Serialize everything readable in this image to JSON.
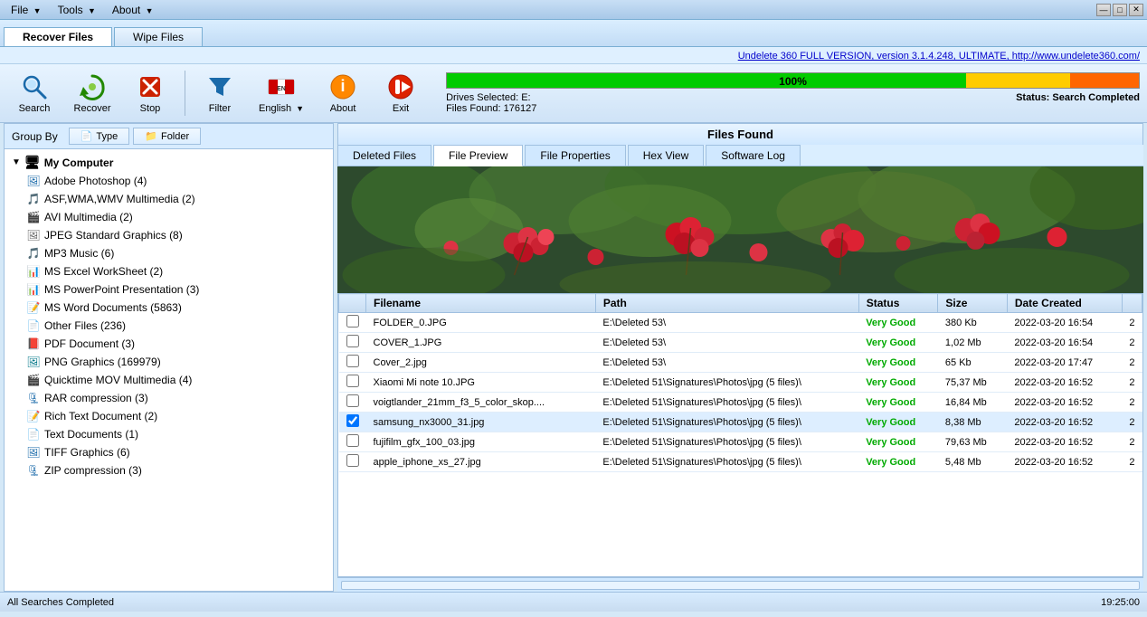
{
  "titlebar": {
    "menus": [
      {
        "label": "File",
        "has_arrow": true
      },
      {
        "label": "Tools",
        "has_arrow": true
      },
      {
        "label": "About",
        "has_arrow": true
      }
    ],
    "win_controls": [
      "—",
      "□",
      "✕"
    ]
  },
  "tabs": {
    "main_tabs": [
      "Recover Files",
      "Wipe Files"
    ],
    "active_main": "Recover Files"
  },
  "link_bar": {
    "text": "Undelete 360 FULL VERSION, version 3.1.4.248, ULTIMATE, http://www.undelete360.com/"
  },
  "toolbar": {
    "buttons": [
      {
        "id": "search",
        "label": "Search",
        "icon": "🔍"
      },
      {
        "id": "recover",
        "label": "Recover",
        "icon": "♻"
      },
      {
        "id": "stop",
        "label": "Stop",
        "icon": "✖"
      },
      {
        "id": "filter",
        "label": "Filter",
        "icon": "▼"
      },
      {
        "id": "english",
        "label": "English",
        "icon": "🌐",
        "has_arrow": true
      },
      {
        "id": "about",
        "label": "About",
        "icon": "ℹ"
      },
      {
        "id": "exit",
        "label": "Exit",
        "icon": "⏹"
      }
    ]
  },
  "progress": {
    "percent": "100%",
    "drives_selected": "Drives Selected: E:",
    "files_found": "Files Found: 176127",
    "status_label": "Status:",
    "status_value": "Search Completed",
    "bar_green_pct": 75,
    "bar_yellow_pct": 15,
    "bar_orange_pct": 10
  },
  "group_by": {
    "label": "Group By",
    "buttons": [
      {
        "id": "type",
        "label": "Type",
        "icon": "📄"
      },
      {
        "id": "folder",
        "label": "Folder",
        "icon": "📁"
      }
    ]
  },
  "tree": {
    "root": {
      "label": "My Computer",
      "icon": "🖥",
      "expanded": true
    },
    "items": [
      {
        "label": "Adobe Photoshop (4)",
        "icon": "🖼",
        "color": "icon-blue"
      },
      {
        "label": "ASF,WMA,WMV Multimedia (2)",
        "icon": "🎵",
        "color": "icon-blue"
      },
      {
        "label": "AVI Multimedia (2)",
        "icon": "🎬",
        "color": "icon-blue"
      },
      {
        "label": "JPEG Standard Graphics (8)",
        "icon": "🖼",
        "color": "icon-gray"
      },
      {
        "label": "MP3 Music (6)",
        "icon": "🎵",
        "color": "icon-gray"
      },
      {
        "label": "MS Excel WorkSheet (2)",
        "icon": "📊",
        "color": "icon-green"
      },
      {
        "label": "MS PowerPoint Presentation (3)",
        "icon": "📊",
        "color": "icon-orange"
      },
      {
        "label": "MS Word Documents (5863)",
        "icon": "📝",
        "color": "icon-blue"
      },
      {
        "label": "Other Files (236)",
        "icon": "📄",
        "color": "icon-gray"
      },
      {
        "label": "PDF Document (3)",
        "icon": "📕",
        "color": "icon-red"
      },
      {
        "label": "PNG Graphics (169979)",
        "icon": "🖼",
        "color": "icon-teal"
      },
      {
        "label": "Quicktime MOV Multimedia (4)",
        "icon": "🎬",
        "color": "icon-blue"
      },
      {
        "label": "RAR compression (3)",
        "icon": "🗜",
        "color": "icon-blue"
      },
      {
        "label": "Rich Text Document (2)",
        "icon": "📝",
        "color": "icon-blue"
      },
      {
        "label": "Text Documents (1)",
        "icon": "📄",
        "color": "icon-gray"
      },
      {
        "label": "TIFF Graphics (6)",
        "icon": "🖼",
        "color": "icon-blue"
      },
      {
        "label": "ZIP compression (3)",
        "icon": "🗜",
        "color": "icon-blue"
      }
    ]
  },
  "files_found_header": "Files Found",
  "content_tabs": [
    {
      "id": "deleted",
      "label": "Deleted Files"
    },
    {
      "id": "preview",
      "label": "File Preview"
    },
    {
      "id": "properties",
      "label": "File Properties"
    },
    {
      "id": "hex",
      "label": "Hex View"
    },
    {
      "id": "log",
      "label": "Software Log"
    }
  ],
  "active_content_tab": "File Preview",
  "file_table": {
    "columns": [
      "",
      "Filename",
      "Path",
      "Status",
      "Size",
      "Date Created",
      ""
    ],
    "rows": [
      {
        "checked": false,
        "filename": "FOLDER_0.JPG",
        "path": "E:\\Deleted 53\\",
        "status": "Very Good",
        "size": "380 Kb",
        "date": "2022-03-20 16:54",
        "extra": "2"
      },
      {
        "checked": false,
        "filename": "COVER_1.JPG",
        "path": "E:\\Deleted 53\\",
        "status": "Very Good",
        "size": "1,02 Mb",
        "date": "2022-03-20 16:54",
        "extra": "2"
      },
      {
        "checked": false,
        "filename": "Cover_2.jpg",
        "path": "E:\\Deleted 53\\",
        "status": "Very Good",
        "size": "65 Kb",
        "date": "2022-03-20 17:47",
        "extra": "2"
      },
      {
        "checked": false,
        "filename": "Xiaomi Mi note 10.JPG",
        "path": "E:\\Deleted 51\\Signatures\\Photos\\jpg (5 files)\\",
        "status": "Very Good",
        "size": "75,37 Mb",
        "date": "2022-03-20 16:52",
        "extra": "2"
      },
      {
        "checked": false,
        "filename": "voigtlander_21mm_f3_5_color_skop....",
        "path": "E:\\Deleted 51\\Signatures\\Photos\\jpg (5 files)\\",
        "status": "Very Good",
        "size": "16,84 Mb",
        "date": "2022-03-20 16:52",
        "extra": "2"
      },
      {
        "checked": true,
        "filename": "samsung_nx3000_31.jpg",
        "path": "E:\\Deleted 51\\Signatures\\Photos\\jpg (5 files)\\",
        "status": "Very Good",
        "size": "8,38 Mb",
        "date": "2022-03-20 16:52",
        "extra": "2"
      },
      {
        "checked": false,
        "filename": "fujifilm_gfx_100_03.jpg",
        "path": "E:\\Deleted 51\\Signatures\\Photos\\jpg (5 files)\\",
        "status": "Very Good",
        "size": "79,63 Mb",
        "date": "2022-03-20 16:52",
        "extra": "2"
      },
      {
        "checked": false,
        "filename": "apple_iphone_xs_27.jpg",
        "path": "E:\\Deleted 51\\Signatures\\Photos\\jpg (5 files)\\",
        "status": "Very Good",
        "size": "5,48 Mb",
        "date": "2022-03-20 16:52",
        "extra": "2"
      }
    ]
  },
  "status_bar": {
    "left": "All Searches Completed",
    "right": "19:25:00"
  }
}
